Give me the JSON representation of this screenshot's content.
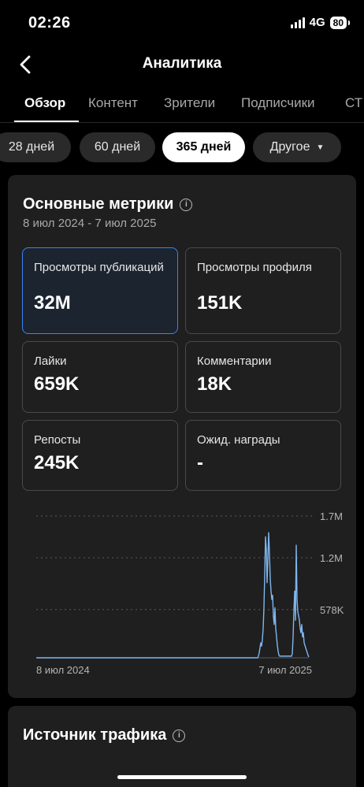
{
  "status_bar": {
    "time": "02:26",
    "network": "4G",
    "battery": "80"
  },
  "header": {
    "title": "Аналитика"
  },
  "tabs": [
    {
      "label": "Обзор",
      "active": true
    },
    {
      "label": "Контент"
    },
    {
      "label": "Зрители"
    },
    {
      "label": "Подписчики"
    },
    {
      "label": "СТ"
    }
  ],
  "periods": [
    {
      "label": "28 дней"
    },
    {
      "label": "60 дней"
    },
    {
      "label": "365 дней",
      "active": true
    },
    {
      "label": "Другое",
      "dropdown": true
    }
  ],
  "main_card": {
    "title": "Основные метрики",
    "date_range": "8 июл 2024 - 7 июл 2025",
    "metrics": [
      {
        "label": "Просмотры публикаций",
        "value": "32M",
        "selected": true
      },
      {
        "label": "Просмотры профиля",
        "value": "151K"
      },
      {
        "label": "Лайки",
        "value": "659K"
      },
      {
        "label": "Комментарии",
        "value": "18K"
      },
      {
        "label": "Репосты",
        "value": "245K"
      },
      {
        "label": "Ожид. награды",
        "value": "-"
      }
    ]
  },
  "chart_data": {
    "type": "line",
    "title": "",
    "x_start_label": "8 июл 2024",
    "x_end_label": "7 июл 2025",
    "y_tick_labels": [
      "1.7M",
      "1.2M",
      "578K"
    ],
    "y_ticks": [
      1700000,
      1200000,
      578000
    ],
    "ylim": [
      0,
      1700000
    ],
    "grid": true,
    "line_color": "#7fb6f0",
    "series": [
      {
        "values": [
          0,
          0,
          0,
          0,
          0,
          0,
          0,
          0,
          0,
          0,
          0,
          0,
          0,
          0,
          0,
          0,
          0,
          0,
          0,
          0,
          0,
          0,
          0,
          0,
          0,
          0,
          0,
          0,
          0,
          0,
          0,
          0,
          0,
          0,
          0,
          0,
          0,
          0,
          0,
          0,
          0,
          0,
          0,
          0,
          0,
          0,
          0,
          0,
          0,
          0,
          0,
          0,
          0,
          0,
          0,
          0,
          0,
          0,
          0,
          0,
          0,
          0,
          0,
          0,
          0,
          0,
          0,
          0,
          0,
          0,
          0,
          0,
          0,
          0,
          0,
          0,
          0,
          0,
          0,
          0,
          0,
          0,
          0,
          0,
          0,
          0,
          0,
          0,
          0,
          0,
          0,
          0,
          0,
          0,
          0,
          0,
          0,
          0,
          0,
          0,
          0,
          0,
          0,
          0,
          0,
          0,
          0,
          0,
          0,
          0,
          0,
          0,
          0,
          0,
          0,
          0,
          0,
          0,
          0,
          0,
          0,
          0,
          0,
          0,
          0,
          0,
          0,
          0,
          0,
          0,
          0,
          0,
          0,
          0,
          0,
          0,
          0,
          0,
          0,
          0,
          0,
          0,
          0,
          0,
          0,
          0,
          0,
          0,
          0,
          0,
          0,
          0,
          0,
          0,
          0,
          0,
          0,
          0,
          0,
          0,
          0,
          0,
          0,
          0,
          0,
          0,
          0,
          0,
          0,
          0,
          0,
          0,
          0,
          0,
          0,
          0,
          0,
          0,
          0,
          0,
          0,
          0,
          0,
          0,
          0,
          0,
          0,
          0,
          0,
          0,
          0,
          0,
          0,
          0,
          0,
          0,
          0,
          0,
          0,
          0,
          0,
          0,
          0,
          0,
          0,
          0,
          0,
          0,
          0,
          0,
          0,
          0,
          0,
          0,
          0,
          0,
          0,
          0,
          0,
          0,
          0,
          0,
          0,
          0,
          0,
          0,
          0,
          0,
          0,
          0,
          0,
          0,
          0,
          0,
          0,
          0,
          0,
          0,
          0,
          0,
          0,
          0,
          0,
          0,
          0,
          0,
          0,
          0,
          0,
          0,
          0,
          0,
          0,
          0,
          0,
          0,
          0,
          0,
          0,
          0,
          0,
          0,
          0,
          0,
          0,
          0,
          0,
          0,
          0,
          0,
          0,
          0,
          0,
          0,
          0,
          0,
          0,
          0,
          0,
          0,
          0,
          0,
          20000,
          60000,
          120000,
          180000,
          140000,
          220000,
          350000,
          600000,
          1000000,
          1450000,
          1300000,
          900000,
          1200000,
          1500000,
          1250000,
          950000,
          800000,
          700000,
          750000,
          500000,
          400000,
          600000,
          350000,
          250000,
          150000,
          80000,
          30000,
          20000,
          20000,
          20000,
          20000,
          20000,
          20000,
          20000,
          20000,
          20000,
          20000,
          20000,
          20000,
          20000,
          20000,
          20000,
          20000,
          50000,
          250000,
          550000,
          800000,
          450000,
          1350000,
          700000,
          550000,
          500000,
          450000,
          350000,
          300000,
          400000,
          250000,
          300000,
          180000,
          150000,
          120000,
          90000,
          60000,
          30000,
          10000
        ]
      }
    ]
  },
  "traffic_card": {
    "title": "Источник трафика"
  }
}
